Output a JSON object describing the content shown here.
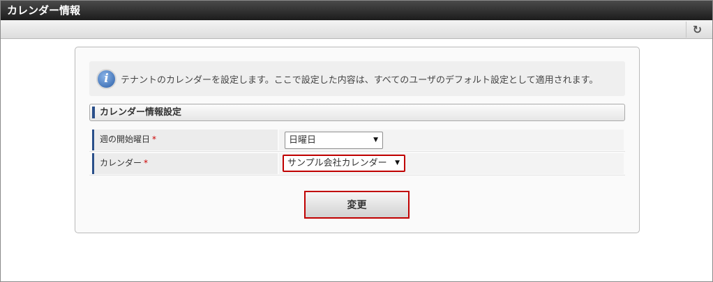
{
  "window": {
    "title": "カレンダー情報"
  },
  "toolbar": {
    "refresh_icon": "refresh-icon"
  },
  "info": {
    "icon": "info-icon",
    "message": "テナントのカレンダーを設定します。ここで設定した内容は、すべてのユーザのデフォルト設定として適用されます。"
  },
  "section": {
    "title": "カレンダー情報設定"
  },
  "form": {
    "rows": [
      {
        "label": "週の開始曜日",
        "required": "*",
        "value": "日曜日"
      },
      {
        "label": "カレンダー",
        "required": "*",
        "value": "サンプル会社カレンダー"
      }
    ],
    "submit_label": "変更"
  },
  "colors": {
    "accent": "#2a4f8a",
    "highlight": "#c00000",
    "titlebar": "#2b2b2b"
  }
}
